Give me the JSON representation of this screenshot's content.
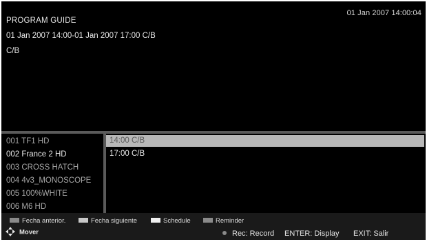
{
  "header": {
    "clock": "01 Jan 2007 14:00:04",
    "title": "PROGRAM GUIDE",
    "event_time": "01 Jan 2007 14:00-01 Jan 2007 17:00 C/B",
    "event_name": "C/B"
  },
  "channels": [
    {
      "label": "001 TF1 HD"
    },
    {
      "label": "002 France 2 HD"
    },
    {
      "label": "003 CROSS HATCH"
    },
    {
      "label": "004 4v3_MONOSCOPE"
    },
    {
      "label": "005 100%WHITE"
    },
    {
      "label": "006 M6 HD"
    }
  ],
  "events": [
    {
      "label": "14:00 C/B"
    },
    {
      "label": "17:00 C/B"
    }
  ],
  "footer": {
    "legend": [
      {
        "label": "Fecha anterior.",
        "color": "#8a8a8a"
      },
      {
        "label": "Fecha siguiente",
        "color": "#c8c8c8"
      },
      {
        "label": "Schedule",
        "color": "#f0f0f0"
      },
      {
        "label": "Reminder",
        "color": "#8a8a8a"
      }
    ],
    "move_label": "Mover",
    "record_hint": "Rec: Record",
    "enter_hint": "ENTER: Display",
    "exit_hint": "EXIT: Salir"
  },
  "colors": {
    "background": "#000000",
    "selected_row": "#b8b8b8",
    "divider": "#5a5a5a"
  }
}
